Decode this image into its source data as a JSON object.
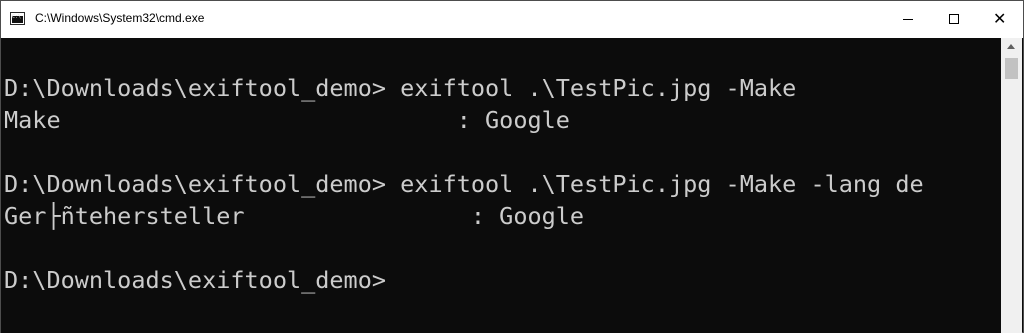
{
  "window": {
    "title": "C:\\Windows\\System32\\cmd.exe",
    "icon": "cmd-console-icon",
    "icon_glyph": "C:\\"
  },
  "caption_buttons": {
    "minimize": "minimize-icon",
    "maximize": "maximize-icon",
    "close": "close-icon",
    "close_glyph": "✕"
  },
  "console": {
    "lines": [
      "D:\\Downloads\\exiftool_demo> exiftool .\\TestPic.jpg -Make",
      "Make                            : Google",
      "",
      "D:\\Downloads\\exiftool_demo> exiftool .\\TestPic.jpg -Make -lang de",
      "Ger├ñtehersteller                : Google",
      "",
      "D:\\Downloads\\exiftool_demo>"
    ]
  },
  "colors": {
    "console_bg": "#0c0c0c",
    "console_fg": "#cccccc",
    "titlebar_bg": "#ffffff"
  }
}
